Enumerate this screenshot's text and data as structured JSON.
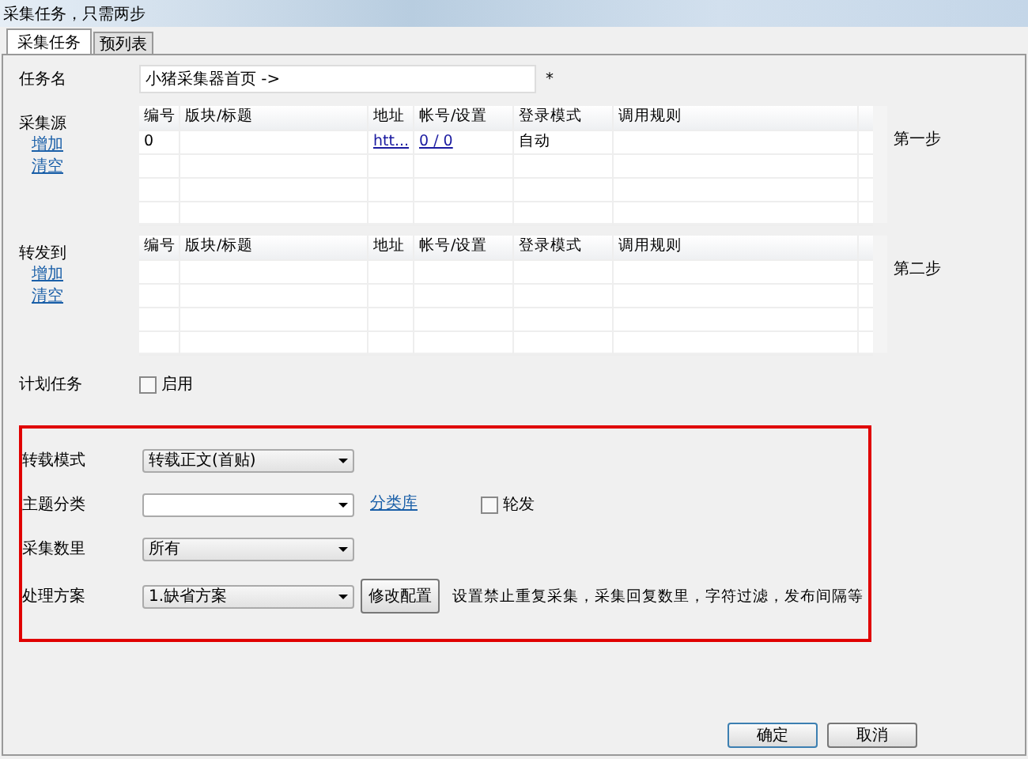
{
  "window": {
    "title": "采集任务，只需两步"
  },
  "tabs": [
    {
      "label": "采集任务",
      "selected": true
    },
    {
      "label": "预列表",
      "selected": false
    }
  ],
  "task_name": {
    "label": "任务名",
    "value": "小猪采集器首页 ->",
    "required_mark": "*"
  },
  "sections": [
    {
      "label": "采集源",
      "links": [
        "增加",
        "清空"
      ],
      "step": "第一步",
      "columns": [
        "编号",
        "版块/标题",
        "地址",
        "帐号/设置",
        "登录模式",
        "调用规则"
      ],
      "rows": [
        [
          {
            "text": "0",
            "kind": "text"
          },
          null,
          {
            "text": "htt...",
            "kind": "link"
          },
          {
            "text": "0 / 0",
            "kind": "link"
          },
          {
            "text": "自动",
            "kind": "text"
          },
          null
        ]
      ]
    },
    {
      "label": "转发到",
      "links": [
        "增加",
        "清空"
      ],
      "step": "第二步",
      "columns": [
        "编号",
        "版块/标题",
        "地址",
        "帐号/设置",
        "登录模式",
        "调用规则"
      ]
    }
  ],
  "schedule": {
    "label": "计划任务",
    "checkbox": {
      "label": "启用",
      "checked": false
    }
  },
  "settings": [
    {
      "label": "转载模式",
      "value": "转载正文(首贴)",
      "kind": "select"
    },
    {
      "label": "主题分类",
      "kind": "select-link",
      "link": "分类库",
      "checkbox": {
        "label": "轮发",
        "checked": false
      }
    },
    {
      "label": "采集数里",
      "value": "所有",
      "kind": "select"
    },
    {
      "label": "处理方案",
      "value": "1.缺省方案",
      "kind": "select-button",
      "button": "修改配置",
      "note": "设置禁止重复采集，采集回复数里，字符过滤，发布间隔等"
    }
  ],
  "buttons": [
    "确定",
    "取消"
  ]
}
